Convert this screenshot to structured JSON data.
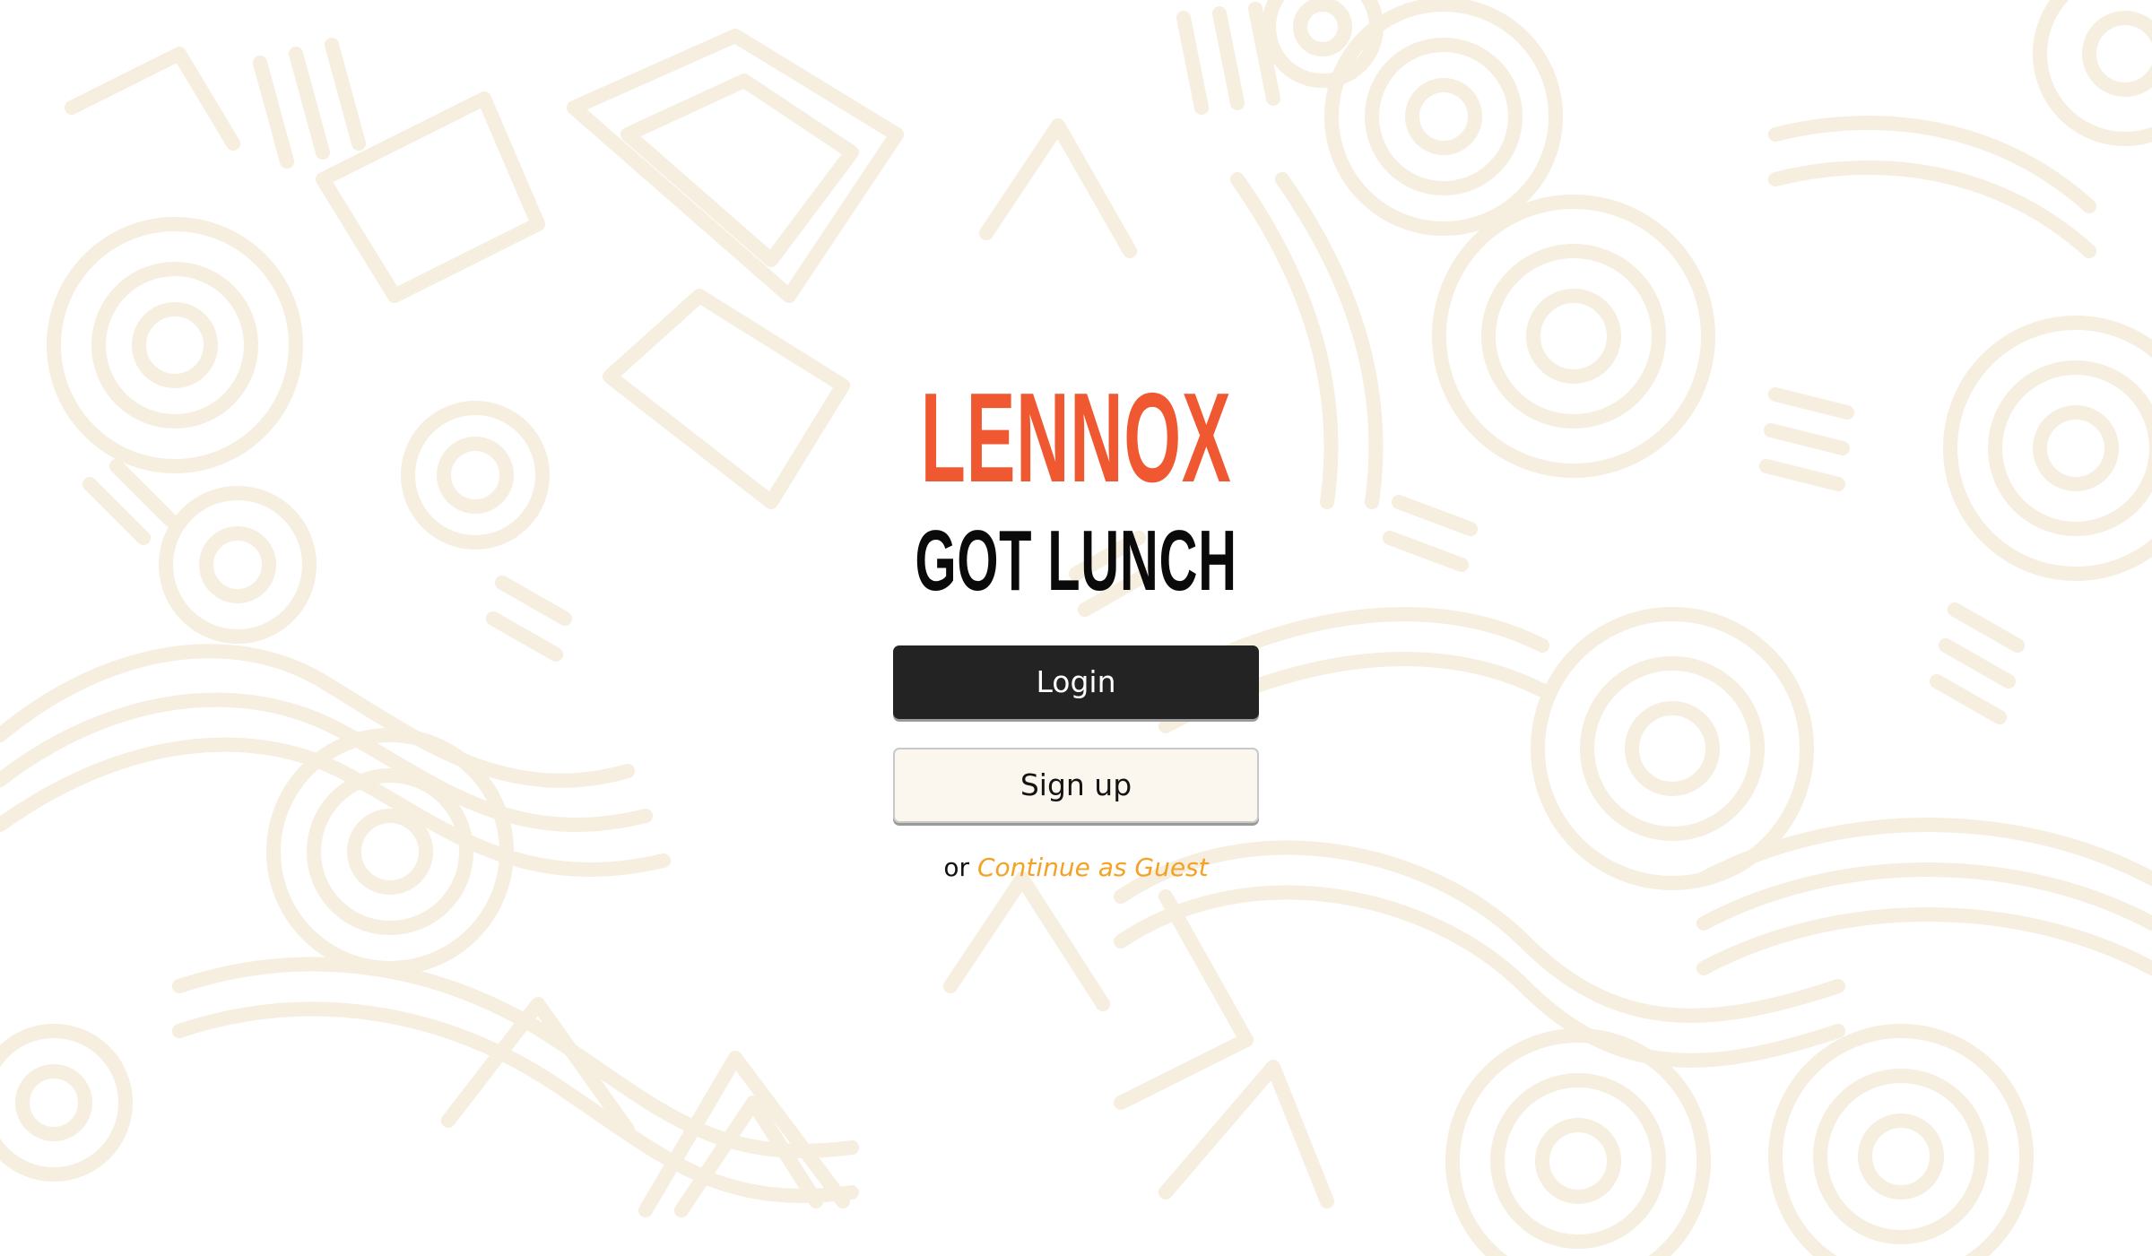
{
  "brand": {
    "name": "LENNOX",
    "tagline": "GOT LUNCH",
    "name_color": "#ef5830",
    "tagline_color": "#0a0a0a"
  },
  "actions": {
    "login_label": "Login",
    "signup_label": "Sign up",
    "or_text": "or",
    "guest_label": "Continue as Guest"
  },
  "theme": {
    "background": "#ffffff",
    "pattern_color": "#f6eedf",
    "login_bg": "#232323",
    "signup_bg": "#fbf7ef",
    "guest_link_color": "#f3a226",
    "icon": "doodle-pattern-background"
  }
}
